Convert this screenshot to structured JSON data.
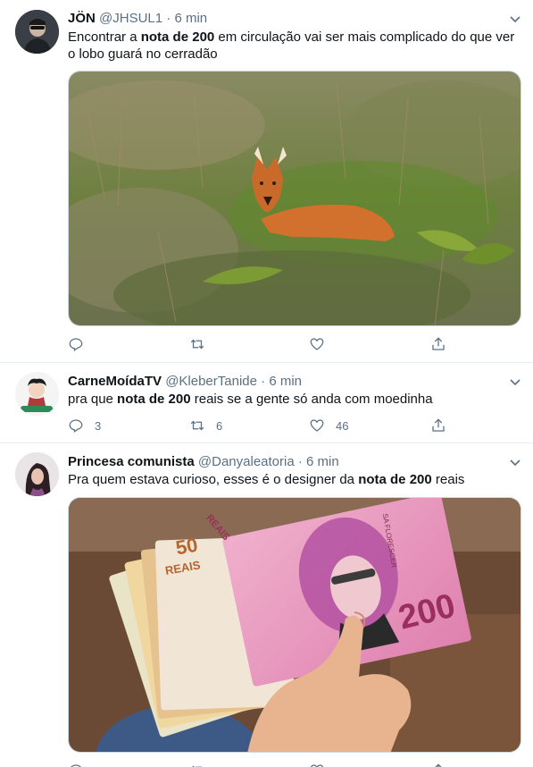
{
  "tweets": [
    {
      "name": "JÖN",
      "handle": "@JHSUL1",
      "dot": "·",
      "time": "6 min",
      "text_pre": "Encontrar a ",
      "text_bold": "nota de 200",
      "text_post": " em circulação vai ser mais complicado do que ver o lobo guará no cerradão",
      "media_icon": "maned-wolf-photo",
      "actions": {
        "reply": "",
        "retweet": "",
        "like": ""
      }
    },
    {
      "name": "CarneMoídaTV",
      "handle": "@KleberTanide",
      "dot": "·",
      "time": "6 min",
      "text_pre": "pra que ",
      "text_bold": "nota de 200",
      "text_post": " reais se a gente só anda com moedinha",
      "actions": {
        "reply": "3",
        "retweet": "6",
        "like": "46"
      }
    },
    {
      "name": "Princesa comunista",
      "handle": "@Danyaleatoria",
      "dot": "·",
      "time": "6 min",
      "text_pre": "Pra quem estava curioso, esses é o designer da ",
      "text_bold": "nota de 200",
      "text_post": " reais",
      "media_icon": "banknotes-photo",
      "media_texts": {
        "note_value": "200",
        "note_currency": "REAIS",
        "fan_value": "50",
        "fan_currency": "REAIS",
        "vertical": "SA FLORESCER"
      }
    }
  ],
  "colors": {
    "text": "#0f1419",
    "muted": "#5b7083",
    "divider": "#e6ecf0"
  }
}
